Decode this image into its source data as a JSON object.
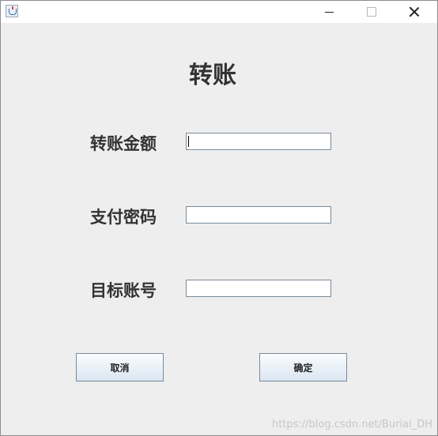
{
  "window": {
    "title": "",
    "controls": {
      "minimize": "minimize",
      "maximize": "maximize",
      "close": "close"
    }
  },
  "form": {
    "heading": "转账",
    "fields": [
      {
        "label": "转账金额",
        "value": "",
        "placeholder": ""
      },
      {
        "label": "支付密码",
        "value": "",
        "placeholder": ""
      },
      {
        "label": "目标账号",
        "value": "",
        "placeholder": ""
      }
    ],
    "buttons": {
      "cancel": "取消",
      "confirm": "确定"
    }
  },
  "watermark": "https://blog.csdn.net/Burial_DH",
  "icons": {
    "app": "java-app-icon",
    "minimize": "minimize-icon",
    "maximize": "maximize-icon",
    "close": "close-icon"
  }
}
